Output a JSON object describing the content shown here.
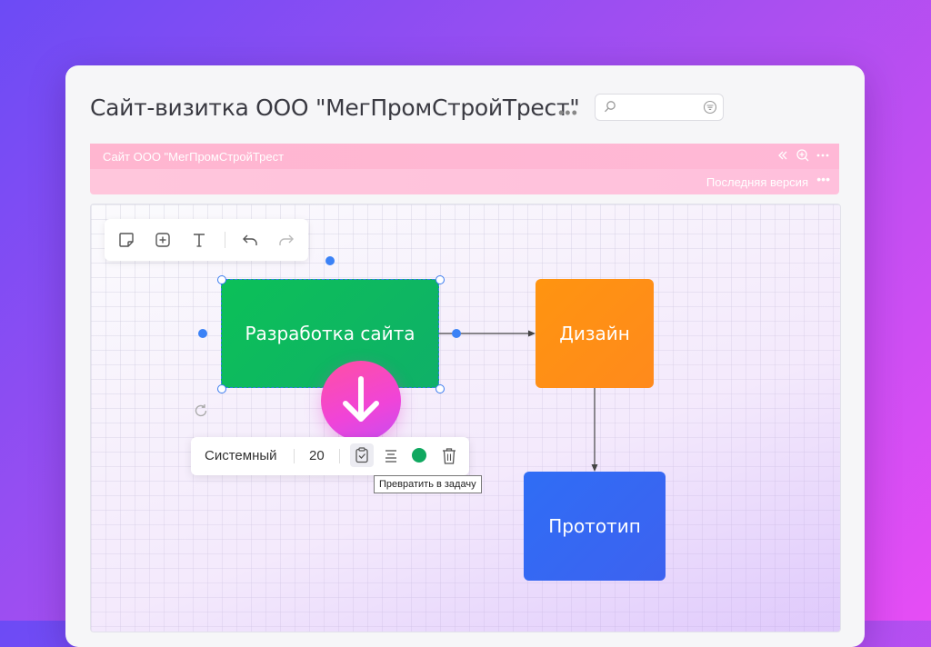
{
  "header": {
    "title": "Сайт-визитка ООО \"МегПромСтройТрест\"",
    "more_label": "•••",
    "search_placeholder": ""
  },
  "doc_bar": {
    "name": "Сайт ООО \"МегПромСтройТрест",
    "version_label": "Последняя версия",
    "more_label": "•••"
  },
  "toolbar": {
    "icons": [
      "sticky-note-icon",
      "add-frame-icon",
      "text-icon",
      "undo-icon",
      "redo-icon"
    ]
  },
  "nodes": [
    {
      "label": "Разработка сайта",
      "color": "#0cc058"
    },
    {
      "label": "Дизайн",
      "color": "#ff9410"
    },
    {
      "label": "Прототип",
      "color": "#2f6df5"
    }
  ],
  "format_bar": {
    "font": "Системный",
    "font_size": "20",
    "selected_color": "#10a860",
    "tooltip": "Превратить в задачу"
  },
  "colors": {
    "selection": "#3a7bef",
    "accent_pink": "#ff4fa3"
  }
}
